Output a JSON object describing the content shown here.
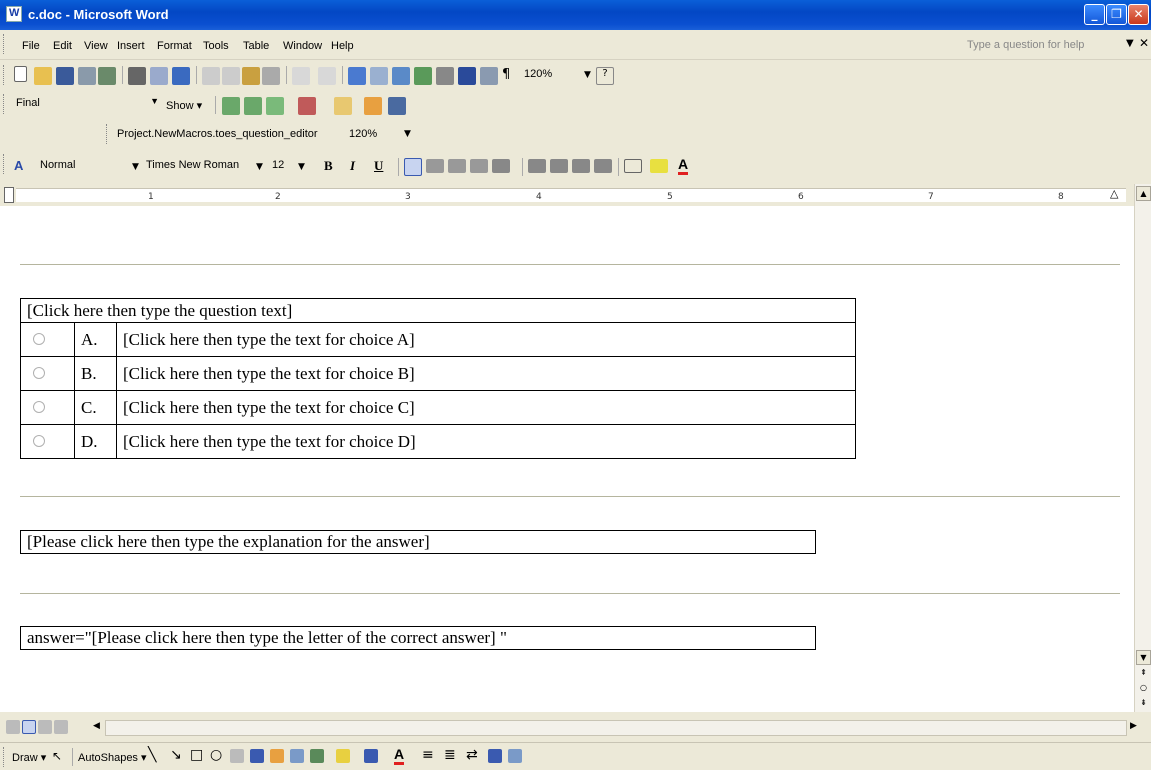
{
  "window": {
    "title": "c.doc - Microsoft Word"
  },
  "menu": {
    "items": [
      "File",
      "Edit",
      "View",
      "Insert",
      "Format",
      "Tools",
      "Table",
      "Window",
      "Help"
    ],
    "help_placeholder": "Type a question for help"
  },
  "standard_toolbar": {
    "zoom": "120%"
  },
  "reviewing_toolbar": {
    "display": "Final",
    "show_label": "Show"
  },
  "macro_toolbar": {
    "macro_name": "Project.NewMacros.toes_question_editor",
    "zoom": "120%"
  },
  "formatting_toolbar": {
    "style": "Normal",
    "font": "Times New Roman",
    "size": "12",
    "bold": "B",
    "italic": "I",
    "underline": "U"
  },
  "ruler": {
    "numbers": [
      "1",
      "2",
      "3",
      "4",
      "5",
      "6",
      "7",
      "8"
    ]
  },
  "document": {
    "question": "[Click here then type the question text]",
    "choices": [
      {
        "letter": "A.",
        "text": "[Click here then type the text for choice A]"
      },
      {
        "letter": "B.",
        "text": "[Click here then type the text for choice B]"
      },
      {
        "letter": "C.",
        "text": "[Click here then type the text for choice C]"
      },
      {
        "letter": "D.",
        "text": "[Click here then type the text for choice D]"
      }
    ],
    "explanation": "[Please click here then type the explanation for the answer]",
    "answer": "answer=\"[Please click here then type the letter of the correct answer] \""
  },
  "drawing_toolbar": {
    "draw_label": "Draw",
    "autoshapes_label": "AutoShapes"
  },
  "colors": {
    "titlebar": "#0a4fd0",
    "chrome": "#ece9d8"
  }
}
